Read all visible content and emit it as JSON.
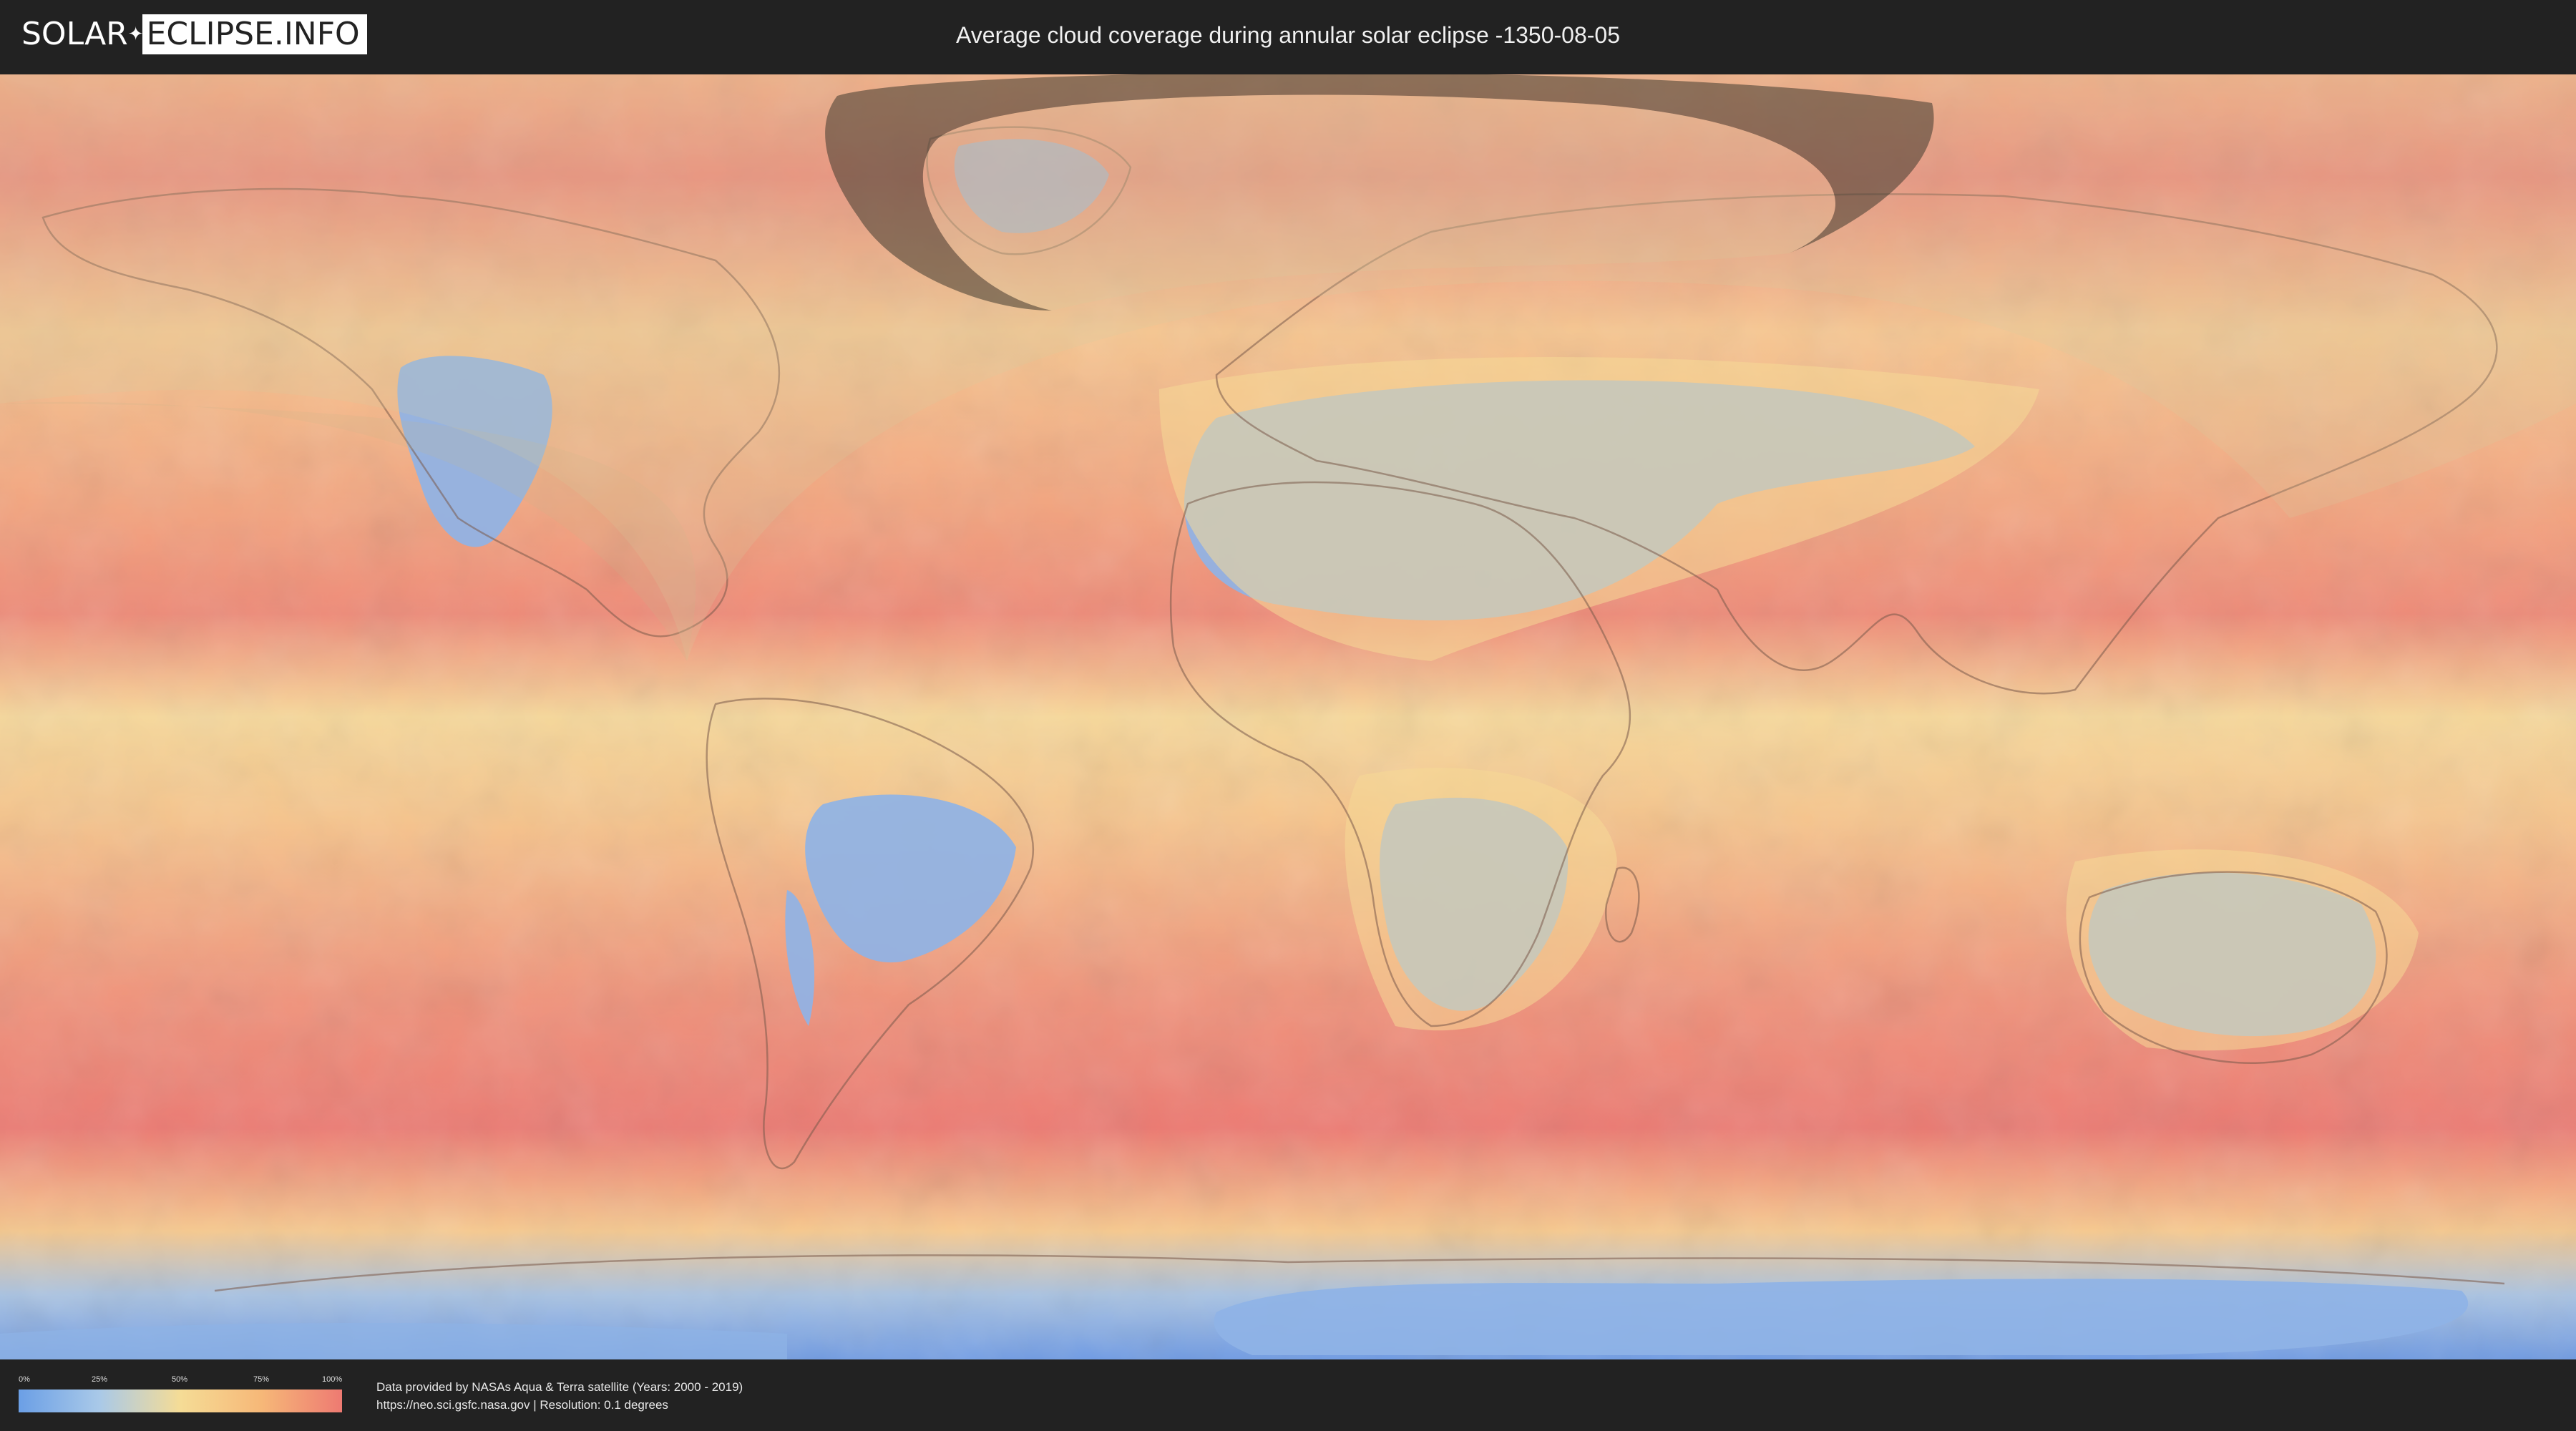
{
  "header": {
    "logo_left": "SOLAR",
    "logo_right": "ECLIPSE.INFO",
    "title": "Average cloud coverage during annular solar eclipse -1350-08-05"
  },
  "legend": {
    "ticks": [
      "0%",
      "25%",
      "50%",
      "75%",
      "100%"
    ],
    "colors": [
      "#6b9fe6",
      "#a9c9e8",
      "#f5dc96",
      "#f6b878",
      "#ee7a72"
    ]
  },
  "credits": {
    "line1": "Data provided by NASAs Aqua & Terra satellite (Years: 2000 - 2019)",
    "line2": "https://neo.sci.gsfc.nasa.gov | Resolution: 0.1 degrees"
  },
  "map": {
    "projection": "equirectangular",
    "colors": {
      "ocean_cloudy": "#ee7f75",
      "mid": "#f6c28a",
      "clear": "#7fa8e4",
      "eclipse_shadow": "#6b6a55",
      "annular_path": "#3f3b30"
    }
  }
}
